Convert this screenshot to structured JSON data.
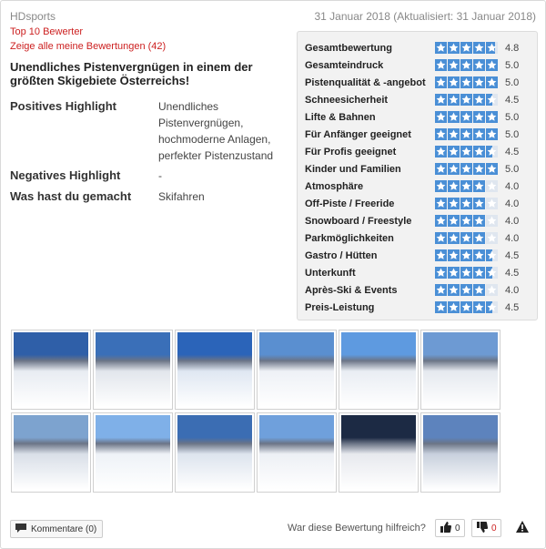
{
  "review": {
    "author": "HDsports",
    "date": "31 Januar 2018 (Aktualisiert: 31 Januar 2018)",
    "top_reviewer": "Top 10 Bewerter",
    "show_all": "Zeige alle meine Bewertungen (42)",
    "title": "Unendliches Pistenvergnügen in einem der größten Skigebiete Österreichs!",
    "fields": [
      {
        "label": "Positives Highlight",
        "value": "Unendliches Pistenvergnügen, hochmoderne Anlagen, perfekter Pistenzustand"
      },
      {
        "label": "Negatives Highlight",
        "value": "-"
      },
      {
        "label": "Was hast du gemacht",
        "value": "Skifahren"
      }
    ]
  },
  "ratings": [
    {
      "label": "Gesamtbewertung",
      "value": "4.8",
      "score": 4.8
    },
    {
      "label": "Gesamteindruck",
      "value": "5.0",
      "score": 5.0
    },
    {
      "label": "Pistenqualität & -angebot",
      "value": "5.0",
      "score": 5.0
    },
    {
      "label": "Schneesicherheit",
      "value": "4.5",
      "score": 4.5
    },
    {
      "label": "Lifte & Bahnen",
      "value": "5.0",
      "score": 5.0
    },
    {
      "label": "Für Anfänger geeignet",
      "value": "5.0",
      "score": 5.0
    },
    {
      "label": "Für Profis geeignet",
      "value": "4.5",
      "score": 4.5
    },
    {
      "label": "Kinder und Familien",
      "value": "5.0",
      "score": 5.0
    },
    {
      "label": "Atmosphäre",
      "value": "4.0",
      "score": 4.0
    },
    {
      "label": "Off-Piste / Freeride",
      "value": "4.0",
      "score": 4.0
    },
    {
      "label": "Snowboard / Freestyle",
      "value": "4.0",
      "score": 4.0
    },
    {
      "label": "Parkmöglichkeiten",
      "value": "4.0",
      "score": 4.0
    },
    {
      "label": "Gastro / Hütten",
      "value": "4.5",
      "score": 4.5
    },
    {
      "label": "Unterkunft",
      "value": "4.5",
      "score": 4.5
    },
    {
      "label": "Après-Ski & Events",
      "value": "4.0",
      "score": 4.0
    },
    {
      "label": "Preis-Leistung",
      "value": "4.5",
      "score": 4.5
    }
  ],
  "photos": [
    {
      "sky": "#2f5fa8",
      "ground": "#e8ecf2"
    },
    {
      "sky": "#3a6fb8",
      "ground": "#e2e6ec"
    },
    {
      "sky": "#2b64b9",
      "ground": "#dfe7f2"
    },
    {
      "sky": "#5a8fd0",
      "ground": "#eef1f6"
    },
    {
      "sky": "#5e9ae0",
      "ground": "#e9edf3"
    },
    {
      "sky": "#6d9ad3",
      "ground": "#e5e9ef"
    },
    {
      "sky": "#7da3cf",
      "ground": "#d9dfe8"
    },
    {
      "sky": "#7fb0e8",
      "ground": "#eef2f7"
    },
    {
      "sky": "#3b6db3",
      "ground": "#dde4ee"
    },
    {
      "sky": "#6fa0dc",
      "ground": "#edf0f5"
    },
    {
      "sky": "#1c2a44",
      "ground": "#e7e9ee"
    },
    {
      "sky": "#5d83bd",
      "ground": "#c8d0dd"
    }
  ],
  "footer": {
    "comments": "Kommentare (0)",
    "helpful_question": "War diese Bewertung hilfreich?",
    "likes": "0",
    "dislikes": "0"
  },
  "colors": {
    "accent_red": "#cc1f1f",
    "star_blue": "#4a8fd6"
  }
}
